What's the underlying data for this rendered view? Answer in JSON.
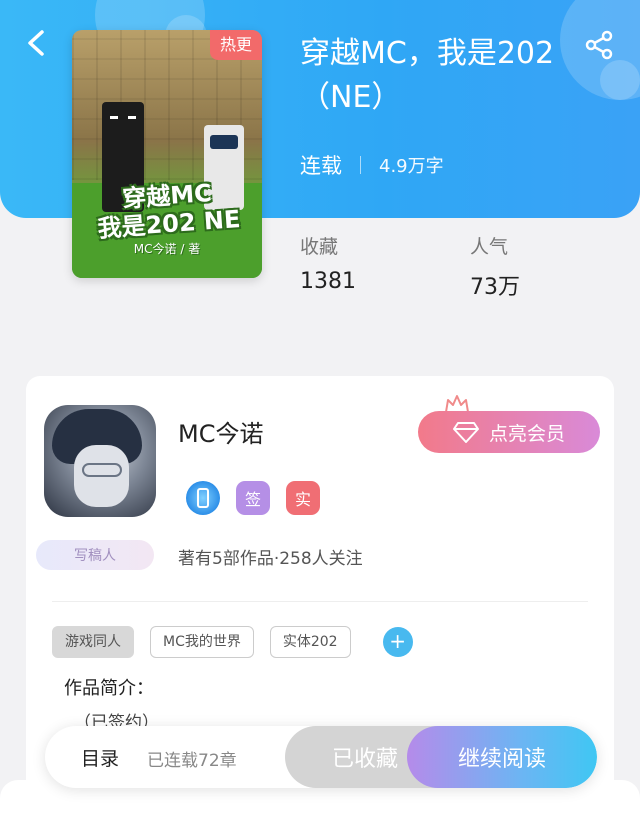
{
  "book": {
    "title": "穿越MC，我是202（NE）",
    "status": "连载",
    "word_count": "4.9万字",
    "hot_tag": "热更",
    "cover_title_line1": "穿越MC",
    "cover_title_line2": "我是202 NE",
    "cover_author": "MC今诺 / 著"
  },
  "stats": {
    "favorites_label": "收藏",
    "favorites_value": "1381",
    "popularity_label": "人气",
    "popularity_value": "73万"
  },
  "author": {
    "name": "MC今诺",
    "vip_button": "点亮会员",
    "badge_sign": "签",
    "badge_real": "实",
    "writer_tag": "写稿人",
    "meta": "著有5部作品·258人关注"
  },
  "tags": [
    "游戏同人",
    "MC我的世界",
    "实体202"
  ],
  "tag_add": "+",
  "intro": {
    "title": "作品简介：",
    "text": "（已签约）"
  },
  "bottom": {
    "toc": "目录",
    "chapters": "已连载72章",
    "favorited": "已收藏",
    "continue": "继续阅读"
  },
  "colors": {
    "header": "#3aaef6",
    "hot_tag": "#f26a6a",
    "accent_blue": "#48b9ef"
  }
}
